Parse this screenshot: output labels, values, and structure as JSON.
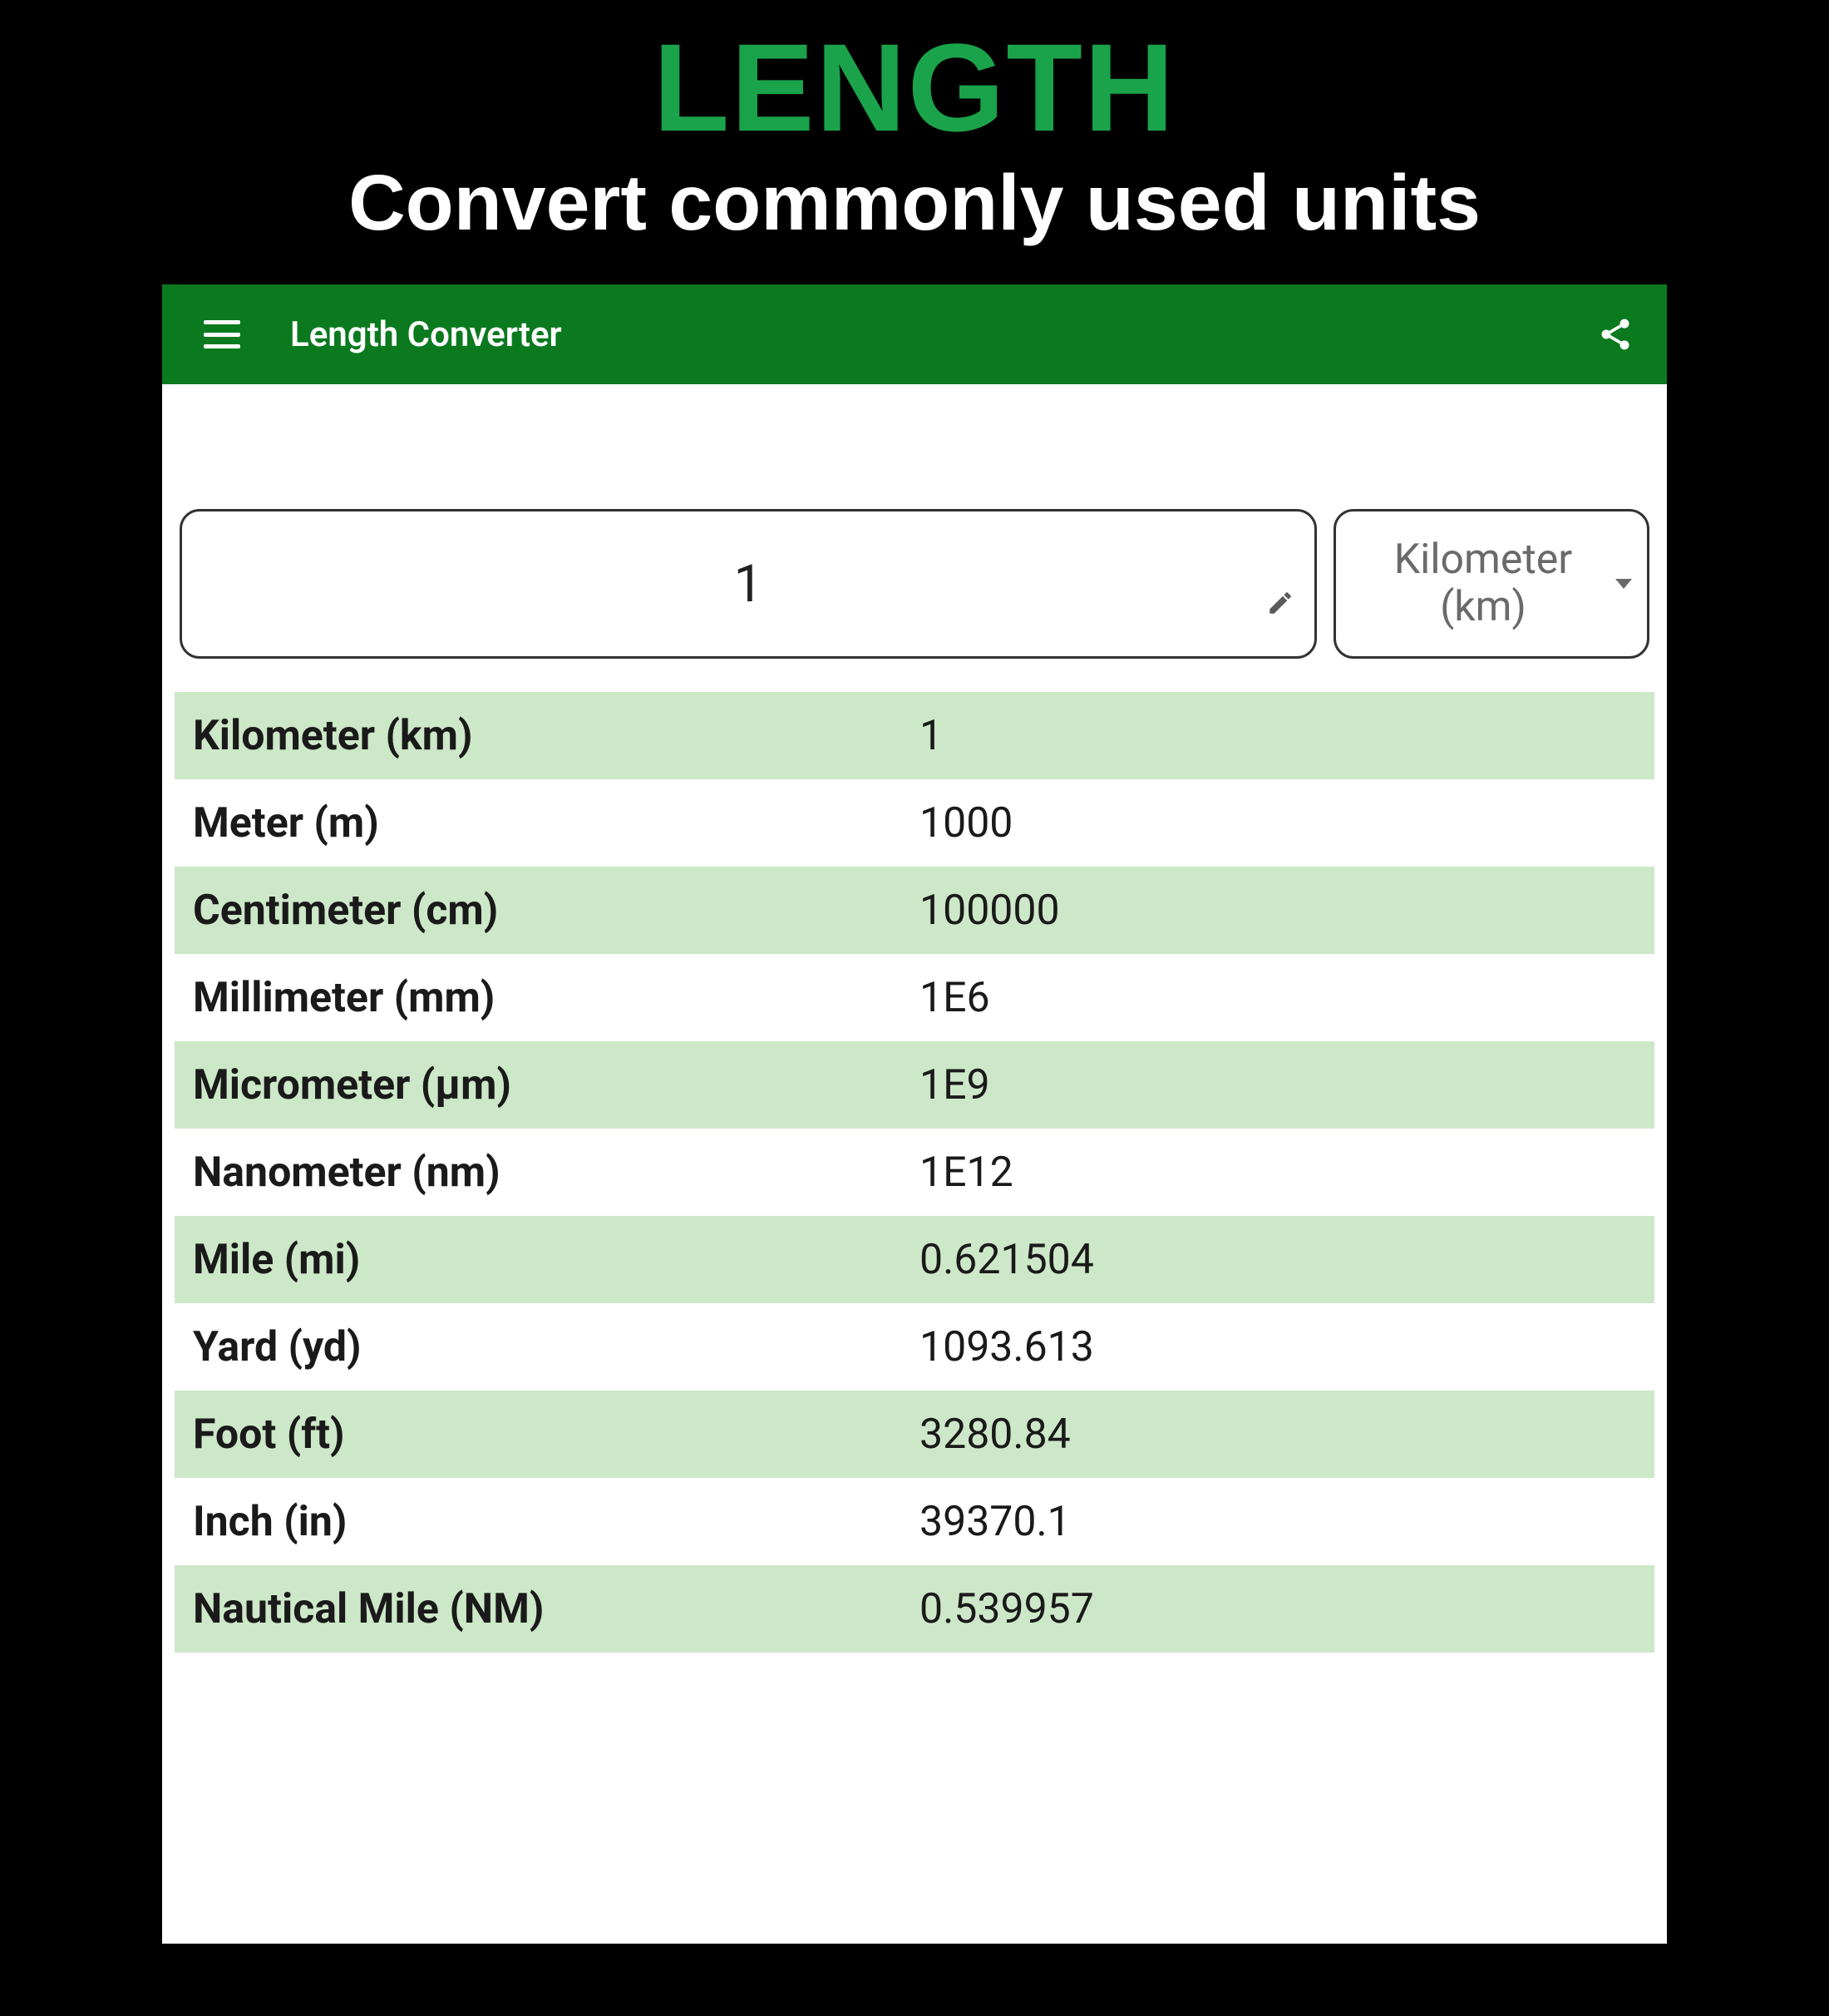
{
  "hero": {
    "title": "LENGTH",
    "subtitle": "Convert commonly used units"
  },
  "appbar": {
    "title": "Length Converter"
  },
  "input": {
    "value": "1",
    "unit_label": "Kilometer (km)"
  },
  "results": [
    {
      "label": "Kilometer (km)",
      "value": "1"
    },
    {
      "label": "Meter (m)",
      "value": "1000"
    },
    {
      "label": "Centimeter (cm)",
      "value": "100000"
    },
    {
      "label": "Millimeter (mm)",
      "value": "1E6"
    },
    {
      "label": "Micrometer (µm)",
      "value": "1E9"
    },
    {
      "label": "Nanometer (nm)",
      "value": "1E12"
    },
    {
      "label": "Mile (mi)",
      "value": "0.621504"
    },
    {
      "label": "Yard (yd)",
      "value": "1093.613"
    },
    {
      "label": "Foot (ft)",
      "value": "3280.84"
    },
    {
      "label": "Inch (in)",
      "value": "39370.1"
    },
    {
      "label": "Nautical Mile (NM)",
      "value": "0.539957"
    }
  ]
}
